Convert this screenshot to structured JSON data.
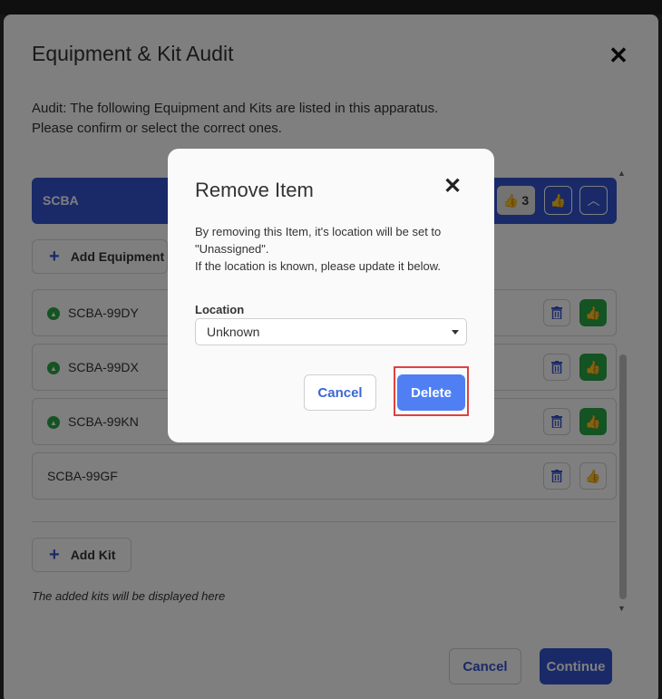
{
  "main": {
    "title": "Equipment & Kit Audit",
    "close_glyph": "✕",
    "intro_line1": "Audit: The following Equipment and Kits are listed in this apparatus.",
    "intro_line2": "Please confirm or select the correct ones.",
    "group": {
      "label": "SCBA",
      "confirmed_count": "3",
      "thumb_glyph": "👍",
      "collapse_glyph": "︿"
    },
    "add_equipment_label": "Add Equipment",
    "items": [
      {
        "label": "SCBA-99DY",
        "confirmed": true
      },
      {
        "label": "SCBA-99DX",
        "confirmed": true
      },
      {
        "label": "SCBA-99KN",
        "confirmed": true
      },
      {
        "label": "SCBA-99GF",
        "confirmed": false
      }
    ],
    "add_kit_label": "Add Kit",
    "kits_note": "The added kits will be displayed here",
    "footer": {
      "cancel_label": "Cancel",
      "continue_label": "Continue"
    }
  },
  "dialog": {
    "title": "Remove Item",
    "close_glyph": "✕",
    "message_line1": "By removing this Item, it's location will be set to",
    "message_line2": "\"Unassigned\".",
    "message_line3": "If the location is known, please update it below.",
    "location_label": "Location",
    "location_value": "Unknown",
    "cancel_label": "Cancel",
    "delete_label": "Delete"
  },
  "colors": {
    "accent": "#3454d1",
    "success": "#28a745",
    "delete": "#4f7ff3",
    "highlight": "#e04141"
  }
}
